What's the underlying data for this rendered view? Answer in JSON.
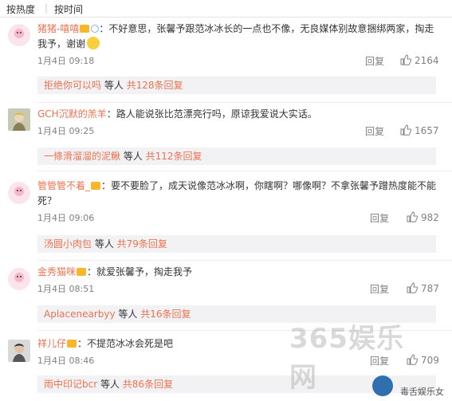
{
  "sort_bar": {
    "hot": "按热度",
    "sep": "|",
    "time": "按时间"
  },
  "comments": [
    {
      "user": "猪猪-嘻嘻",
      "text": "：不好意思，张馨予跟范冰冰长的一点也不像，无良媒体别故意捆绑两家，掏走我予，谢谢",
      "time": "1月4日 09:18",
      "reply": "回复",
      "likes": "2164",
      "sub_user": "拒绝你可以吗",
      "sub_mid": " 等人 ",
      "sub_count": "共128条回复"
    },
    {
      "user": "GCH沉默的羔羊",
      "text": "：路人能说张比范漂亮行吗，原谅我爱说大实话。",
      "time": "1月4日 09:25",
      "reply": "回复",
      "likes": "1657",
      "sub_user": "一條滑溜溜的泥鳅",
      "sub_mid": " 等人 ",
      "sub_count": "共112条回复"
    },
    {
      "user": "管管管不着_",
      "text": "：要不要脸了，成天说像范冰冰啊，你瞎啊？哪像啊？不拿张馨予蹭热度能不能死？",
      "time": "1月4日 09:06",
      "reply": "回复",
      "likes": "982",
      "sub_user": "汤圆小肉包",
      "sub_mid": " 等人 ",
      "sub_count": "共79条回复"
    },
    {
      "user": "金秀猫咪",
      "text": "：就爱张馨予，掏走我予",
      "time": "1月4日 08:51",
      "reply": "回复",
      "likes": "787",
      "sub_user": "Aplacenearbyy",
      "sub_mid": " 等人 ",
      "sub_count": "共16条回复"
    },
    {
      "user": "祥儿仔",
      "text": "：不提范冰冰会死是吧",
      "time": "1月4日 08:46",
      "reply": "回复",
      "likes": "709",
      "sub_user": "雨中印记bcr",
      "sub_mid": " 等人 ",
      "sub_count": "共86条回复"
    }
  ],
  "watermark": {
    "site": "365娱乐网",
    "sub": "毒舌娱乐女"
  }
}
